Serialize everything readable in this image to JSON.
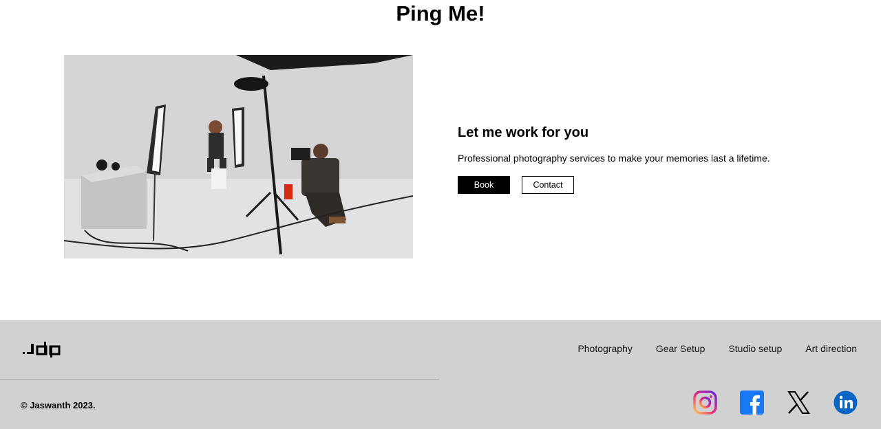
{
  "page": {
    "title": "Ping Me!"
  },
  "hero": {
    "heading": "Let me work for you",
    "description": "Professional photography services to make your memories last a lifetime.",
    "book_label": "Book",
    "contact_label": "Contact",
    "image_alt": "photographer in studio"
  },
  "footer": {
    "logo": ".ʝdp",
    "nav": [
      "Photography",
      "Gear Setup",
      "Studio setup",
      "Art direction"
    ],
    "copyright": "© Jaswanth 2023.",
    "social": [
      "instagram-icon",
      "facebook-icon",
      "x-icon",
      "linkedin-icon"
    ]
  },
  "colors": {
    "footer_bg": "#d1d1d1",
    "facebook": "#1877f2",
    "linkedin": "#0a66c2"
  }
}
